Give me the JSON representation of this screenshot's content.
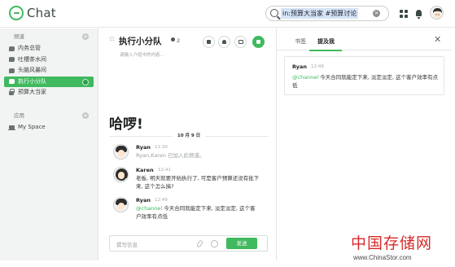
{
  "app": {
    "title": "Chat"
  },
  "search": {
    "query": "in:预算大当家 #预算讨论"
  },
  "sidebar": {
    "channels_title": "频道",
    "channels": [
      {
        "label": "内务总管",
        "icon": "chat-bubble-icon"
      },
      {
        "label": "吐槽茶水间",
        "icon": "chat-bubble-icon"
      },
      {
        "label": "头脑风暴间",
        "icon": "chat-bubble-icon"
      },
      {
        "label": "执行小分队",
        "icon": "chat-bubble-icon",
        "active": true
      },
      {
        "label": "预算大当家",
        "icon": "lock-icon"
      }
    ],
    "apps_title": "应用",
    "apps": [
      {
        "label": "My Space",
        "icon": "laptop-icon"
      }
    ]
  },
  "channel": {
    "title": "执行小分队",
    "member_count": "2",
    "description": "请输入介绍中的内容..."
  },
  "main": {
    "greeting": "哈啰!",
    "date_divider": "10 月 9 日",
    "messages": [
      {
        "author": "Ryan",
        "time": "11:30",
        "text": "Ryan,Karen 已加入此频道。",
        "system": true
      },
      {
        "author": "Karen",
        "time": "12:41",
        "text": "老板, 明天就要开始执行了, 可是客户预算还没有批下来, 这个怎么搞?"
      },
      {
        "author": "Ryan",
        "time": "12:49",
        "mention": "@channel",
        "text": " 今天合同就能定下来, 淡定淡定, 这个客户效率有点低"
      }
    ],
    "composer": {
      "placeholder": "撰写信息",
      "send_label": "发送"
    }
  },
  "right_panel": {
    "tabs": [
      {
        "label": "书签"
      },
      {
        "label": "提及我",
        "active": true
      }
    ],
    "mention_card": {
      "author": "Ryan",
      "time": "12:49",
      "mention": "@channel",
      "text": " 今天合同就能定下来, 淡定淡定, 这个客户效率有点低"
    }
  },
  "watermark": {
    "cn": "中国存储网",
    "url": "www.ChinaStor.com"
  },
  "colors": {
    "accent": "#3fba5e",
    "sidebar_bg": "#f2f4f3",
    "watermark_red": "#d82a2a"
  }
}
